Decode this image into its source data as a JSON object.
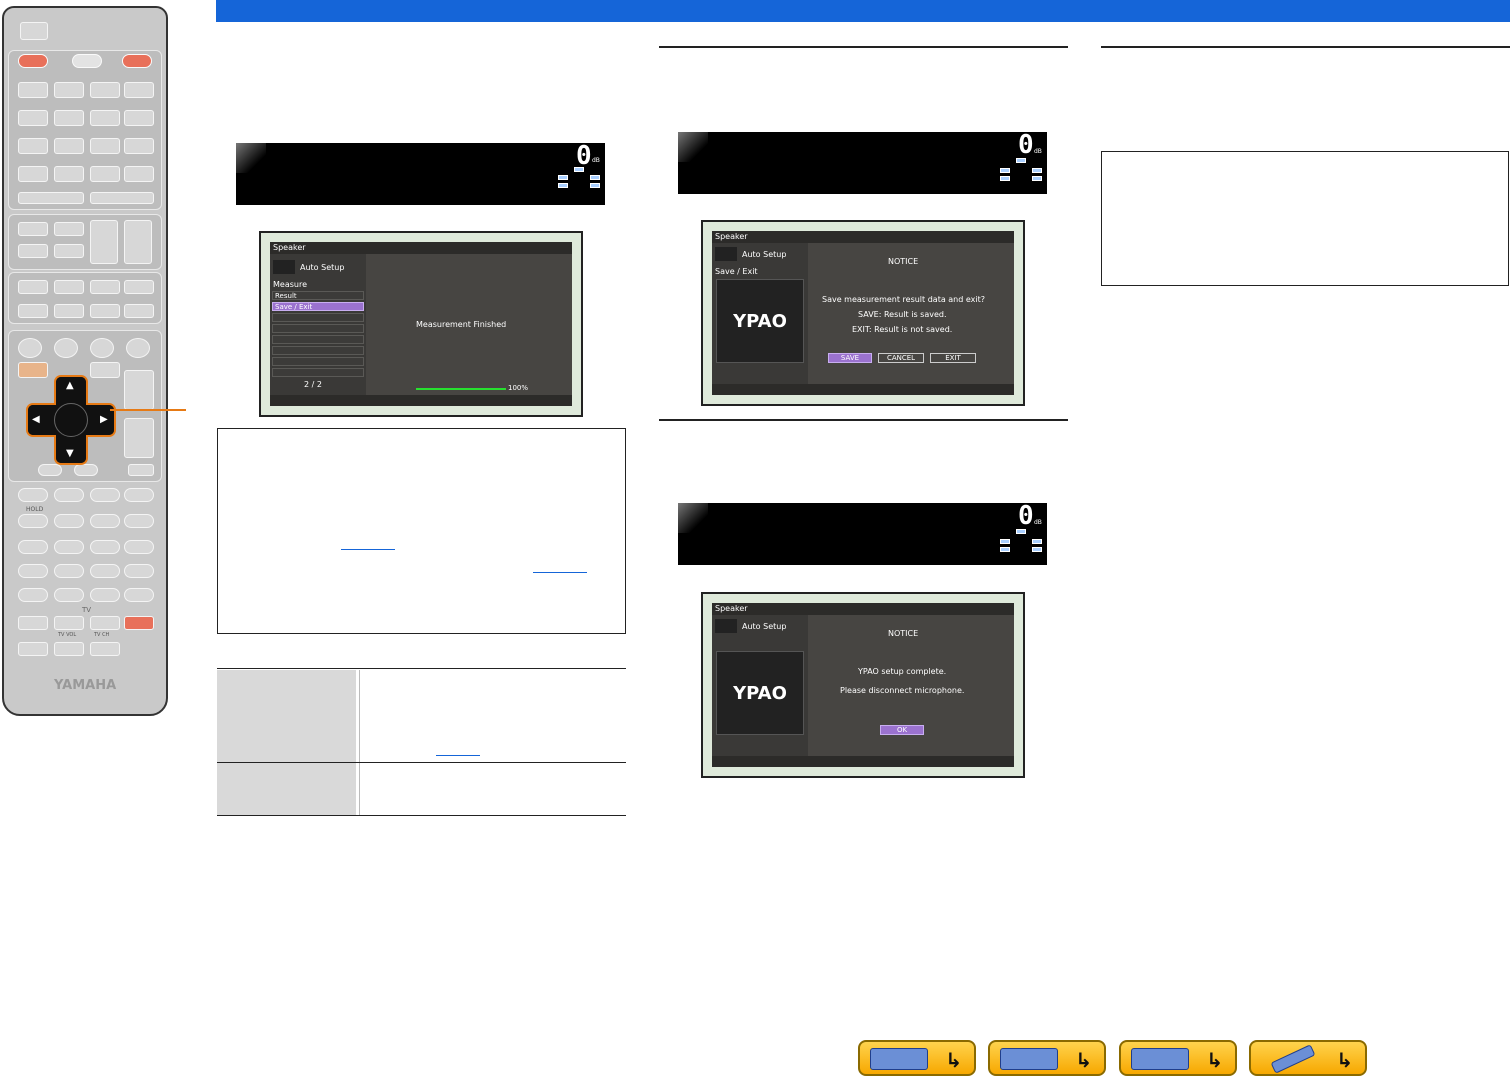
{
  "osd1": {
    "title": "Speaker",
    "mode": "Auto Setup",
    "section": "Measure",
    "items": [
      "Result",
      "Save / Exit"
    ],
    "page": "2 / 2",
    "message": "Measurement Finished",
    "progress_label": "100%",
    "progress": 1.0
  },
  "osd2": {
    "title": "Speaker",
    "mode": "Auto Setup",
    "section": "Save / Exit",
    "logo": "YPAO",
    "notice": "NOTICE",
    "line1": "Save measurement result data and exit?",
    "line2": "SAVE: Result is saved.",
    "line3": "EXIT: Result is not saved.",
    "buttons": [
      "SAVE",
      "CANCEL",
      "EXIT"
    ]
  },
  "osd3": {
    "title": "Speaker",
    "mode": "Auto Setup",
    "logo": "YPAO",
    "notice": "NOTICE",
    "line1": "YPAO setup complete.",
    "line2": "Please disconnect microphone.",
    "button": "OK"
  },
  "lcd": {
    "digits": "0",
    "unit": "dB"
  },
  "remote": {
    "hold_label": "HOLD",
    "tv_label": "TV",
    "tv_vol": "TV VOL",
    "tv_ch": "TV CH",
    "brand": "YAMAHA"
  },
  "colors": {
    "accent": "#1565d8",
    "highlight": "#e67a15",
    "menu_selected": "#9b72cf"
  }
}
